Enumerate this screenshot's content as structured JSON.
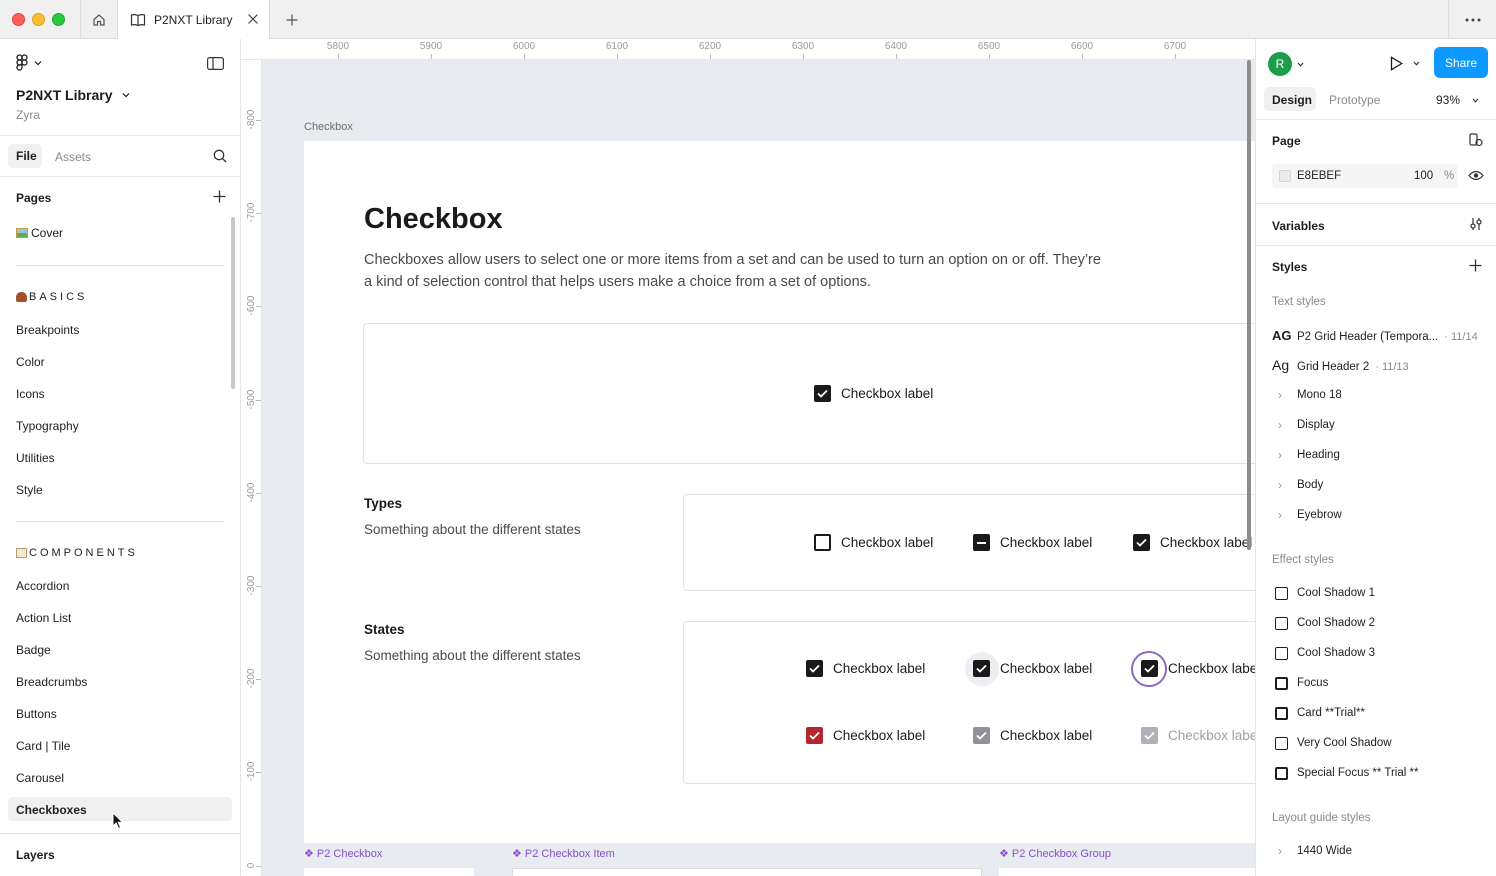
{
  "window": {
    "tab_title": "P2NXT Library"
  },
  "file": {
    "name": "P2NXT Library",
    "team": "Zyra"
  },
  "left_tabs": {
    "file": "File",
    "assets": "Assets"
  },
  "pages": {
    "heading": "Pages",
    "cover": "Cover",
    "basics_heading": "BASICS",
    "basics": [
      "Breakpoints",
      "Color",
      "Icons",
      "Typography",
      "Utilities",
      "Style"
    ],
    "components_heading": "COMPONENTS",
    "components": [
      "Accordion",
      "Action List",
      "Badge",
      "Breadcrumbs",
      "Buttons",
      "Card | Tile",
      "Carousel",
      "Checkboxes"
    ]
  },
  "layers_heading": "Layers",
  "ruler": {
    "top": [
      "5800",
      "5900",
      "6000",
      "6100",
      "6200",
      "6300",
      "6400",
      "6500",
      "6600",
      "6700"
    ],
    "left": [
      "-800",
      "-700",
      "-600",
      "-500",
      "-400",
      "-300",
      "-200",
      "-100",
      "0"
    ]
  },
  "canvas": {
    "frame_label": "Checkbox",
    "title": "Checkbox",
    "description": "Checkboxes allow users to select one or more items from a set and can be used to turn an option on or off. They’re a kind of selection control that helps users make a choice from a set of options.",
    "hero_label": "Checkbox label",
    "types_title": "Types",
    "types_sub": "Something about the different states",
    "types_labels": [
      "Checkbox label",
      "Checkbox label",
      "Checkbox label"
    ],
    "states_title": "States",
    "states_sub": "Something about the different states",
    "states_labels": [
      "Checkbox label",
      "Checkbox label",
      "Checkbox labe",
      "Checkbox label",
      "Checkbox label",
      "Checkbox labe"
    ],
    "components": [
      "P2 Checkbox",
      "P2 Checkbox Item",
      "P2 Checkbox Group"
    ]
  },
  "right": {
    "avatar_initial": "R",
    "share": "Share",
    "tab_design": "Design",
    "tab_prototype": "Prototype",
    "zoom": "93%",
    "page_heading": "Page",
    "page_color": "E8EBEF",
    "page_opacity": "100",
    "percent": "%",
    "variables_heading": "Variables",
    "styles_heading": "Styles",
    "text_styles_heading": "Text styles",
    "text_styles": [
      {
        "icon": "AG",
        "name": "P2 Grid Header (Tempora...",
        "meta": "· 11/14"
      },
      {
        "icon": "Ag",
        "name": "Grid Header 2",
        "meta": "· 11/13"
      }
    ],
    "text_groups": [
      "Mono 18",
      "Display",
      "Heading",
      "Body",
      "Eyebrow"
    ],
    "effect_styles_heading": "Effect styles",
    "effect_styles": [
      "Cool Shadow 1",
      "Cool Shadow 2",
      "Cool Shadow 3",
      "Focus",
      "Card **Trial**",
      "Very Cool Shadow",
      "Special Focus ** Trial **"
    ],
    "layout_heading": "Layout guide styles",
    "layout_styles": [
      "1440 Wide"
    ]
  },
  "colors": {
    "accent": "#0d99ff",
    "canvas": "#E8EBEF",
    "component": "#8a4fcf",
    "error": "#b3262d"
  }
}
